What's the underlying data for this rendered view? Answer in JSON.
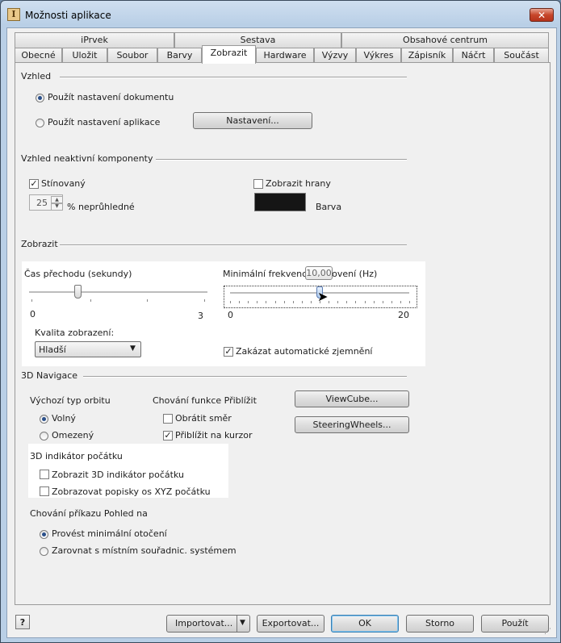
{
  "window": {
    "title": "Možnosti aplikace",
    "icon_glyph": "I",
    "close_glyph": "✕"
  },
  "tabs_top": [
    "iPrvek",
    "Sestava",
    "Obsahové centrum"
  ],
  "tabs_bottom": [
    "Obecné",
    "Uložit",
    "Soubor",
    "Barvy",
    "Zobrazit",
    "Hardware",
    "Výzvy",
    "Výkres",
    "Zápisník",
    "Náčrt",
    "Součást"
  ],
  "active_tab": "Zobrazit",
  "vzhled": {
    "label": "Vzhled",
    "option_doc": "Použít nastavení dokumentu",
    "option_app": "Použít nastavení aplikace",
    "settings_button": "Nastavení...",
    "selected": "option_doc"
  },
  "inactive": {
    "label": "Vzhled neaktivní komponenty",
    "shaded": "Stínovaný",
    "shaded_checked": true,
    "show_edges": "Zobrazit hrany",
    "show_edges_checked": false,
    "opacity_value": "25",
    "opacity_label": "% neprůhledné",
    "color_label": "Barva",
    "color_swatch": "#151515"
  },
  "display": {
    "label": "Zobrazit",
    "transition_label": "Čas přechodu (sekundy)",
    "transition_min": "0",
    "transition_max": "3",
    "transition_value": 0.8,
    "min_rate_label": "Minimální frekvence obnovení (Hz)",
    "min_rate_value": 10,
    "min_rate_tooltip": "10,00",
    "rate_min": "0",
    "rate_max": "20",
    "quality_label": "Kvalita zobrazení:",
    "quality_selected": "Hladší",
    "disable_zoom": "Zakázat automatické zjemnění",
    "disable_zoom_checked": true
  },
  "nav3d": {
    "label": "3D Navigace",
    "orbit_label": "Výchozí typ orbitu",
    "orbit_free": "Volný",
    "orbit_constrained": "Omezený",
    "orbit_selected": "free",
    "zoom_label": "Chování funkce Přiblížit",
    "reverse": "Obrátit směr",
    "reverse_checked": false,
    "zoom_cursor": "Přiblížit na kurzor",
    "zoom_cursor_checked": true,
    "viewcube_button": "ViewCube...",
    "steering_button": "SteeringWheels...",
    "origin_label": "3D indikátor počátku",
    "show_origin": "Zobrazit 3D indikátor počátku",
    "show_xyz": "Zobrazovat popisky os XYZ počátku",
    "view_label": "Chování příkazu Pohled na",
    "min_rotation": "Provést minimální otočení",
    "align_ucs": "Zarovnat s místním souřadnic. systémem",
    "view_selected": "min_rotation"
  },
  "footer": {
    "help_glyph": "?",
    "import": "Importovat...",
    "export": "Exportovat...",
    "ok": "OK",
    "cancel": "Storno",
    "apply": "Použít"
  }
}
